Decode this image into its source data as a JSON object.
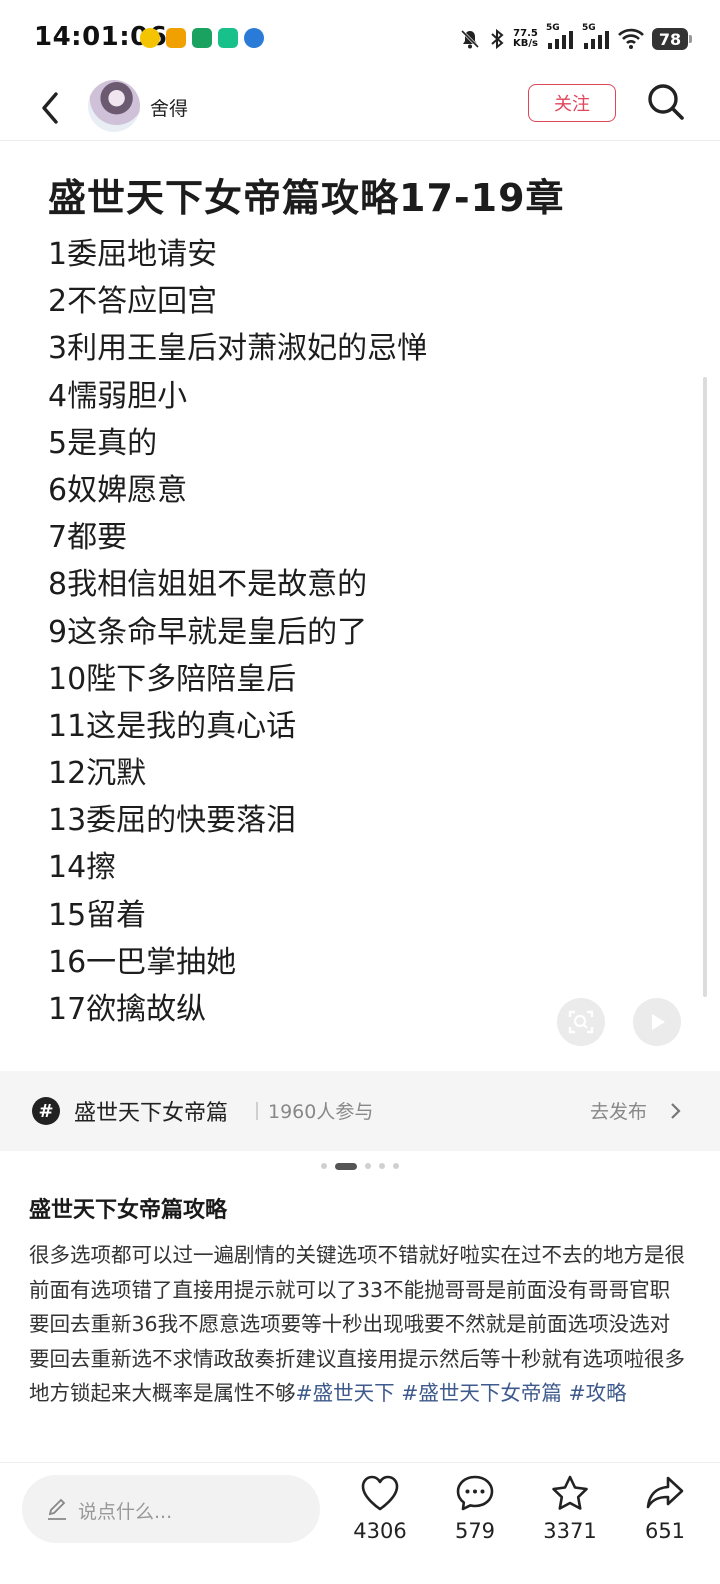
{
  "status_bar": {
    "time": "14:01:06",
    "net_speed_value": "77.5",
    "net_speed_unit": "KB/s",
    "signal_1": "5G",
    "signal_2": "5G",
    "battery": "78"
  },
  "header": {
    "author_name": "舍得",
    "follow_label": "关注"
  },
  "note_image": {
    "title": "盛世天下女帝篇攻略17-19章",
    "answers": [
      "1委屈地请安",
      "2不答应回宫",
      "3利用王皇后对萧淑妃的忌惮",
      "4懦弱胆小",
      "5是真的",
      "6奴婢愿意",
      "7都要",
      "8我相信姐姐不是故意的",
      "9这条命早就是皇后的了",
      "10陛下多陪陪皇后",
      "11这是我的真心话",
      "12沉默",
      "13委屈的快要落泪",
      "14擦",
      "15留着",
      "16一巴掌抽她",
      "17欲擒故纵"
    ]
  },
  "topic": {
    "icon_glyph": "#",
    "name": "盛世天下女帝篇",
    "participants": "1960人参与",
    "action_label": "去发布"
  },
  "pager": {
    "total": 5,
    "active_index": 1
  },
  "description": {
    "title": "盛世天下女帝篇攻略",
    "body": "很多选项都可以过一遍剧情的关键选项不错就好啦实在过不去的地方是很前面有选项错了直接用提示就可以了33不能抛哥哥是前面没有哥哥官职要回去重新36我不愿意选项要等十秒出现哦要不然就是前面选项没选对要回去重新选不求情政敌奏折建议直接用提示然后等十秒就有选项啦很多地方锁起来大概率是属性不够",
    "tags": [
      "#盛世天下",
      "#盛世天下女帝篇",
      "#攻略"
    ]
  },
  "bottom_bar": {
    "comment_placeholder": "说点什么...",
    "likes": "4306",
    "comments": "579",
    "collects": "3371",
    "shares": "651"
  },
  "colors": {
    "accent_red": "#e0455a",
    "tag_blue": "#3e5a8c",
    "topic_bg": "#f5f5f5"
  }
}
